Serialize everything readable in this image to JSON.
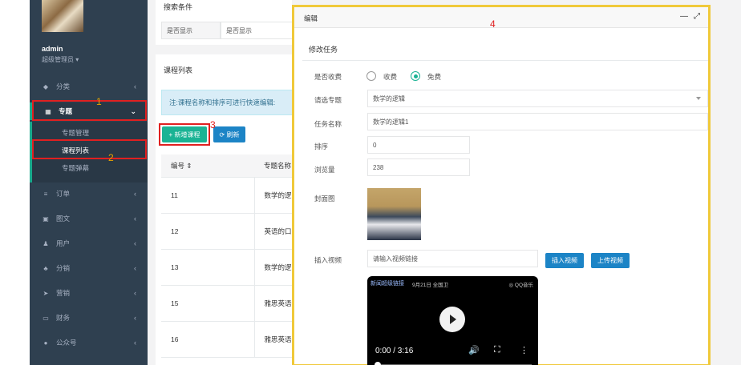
{
  "sidebar": {
    "user_name": "admin",
    "user_role": "超级管理员 ▾",
    "items": [
      {
        "icon": "◆",
        "icon_name": "tag-icon",
        "label": "分类",
        "chev": "‹"
      },
      {
        "icon": "▦",
        "icon_name": "grid-icon",
        "label": "专题",
        "chev": "⌄"
      },
      {
        "icon": "≡",
        "icon_name": "list-icon",
        "label": "订单",
        "chev": "‹"
      },
      {
        "icon": "▣",
        "icon_name": "image-icon",
        "label": "图文",
        "chev": "‹"
      },
      {
        "icon": "♟",
        "icon_name": "user-icon",
        "label": "用户",
        "chev": "‹"
      },
      {
        "icon": "♣",
        "icon_name": "users-icon",
        "label": "分销",
        "chev": "‹"
      },
      {
        "icon": "➤",
        "icon_name": "send-icon",
        "label": "营销",
        "chev": "‹"
      },
      {
        "icon": "▭",
        "icon_name": "finance-icon",
        "label": "财务",
        "chev": "‹"
      },
      {
        "icon": "●",
        "icon_name": "wechat-icon",
        "label": "公众号",
        "chev": "‹"
      }
    ],
    "sub_items": [
      "专题管理",
      "课程列表",
      "专题弹幕"
    ]
  },
  "annotations": {
    "a1": "1",
    "a2": "2",
    "a3": "3",
    "a4": "4"
  },
  "search": {
    "title": "搜索条件",
    "label": "是否显示",
    "select_value": "是否显示"
  },
  "course_list": {
    "title": "课程列表",
    "notice": "注:课程名称和排序可进行快速编辑:",
    "add_button": "+ 新增课程",
    "refresh_button": "⟳ 刷新",
    "columns": [
      "编号 ⇕",
      "专题名称"
    ],
    "rows": [
      [
        "11",
        "数学的逻"
      ],
      [
        "12",
        "英语的口"
      ],
      [
        "13",
        "数学的逻"
      ],
      [
        "15",
        "雅思英语"
      ],
      [
        "16",
        "雅思英语"
      ]
    ]
  },
  "modal": {
    "title": "编辑",
    "minimize": "—",
    "maximize": "⤢",
    "section": "修改任务",
    "charge_label": "是否收费",
    "charge_options": [
      "收费",
      "免费"
    ],
    "charge_selected": "免费",
    "topic_label": "请选专题",
    "topic_value": "数学的逻辑",
    "name_label": "任务名称",
    "name_value": "数学的逻辑1",
    "sort_label": "排序",
    "sort_value": "0",
    "views_label": "浏览量",
    "views_value": "238",
    "cover_label": "封面图",
    "video_label": "插入视频",
    "video_placeholder": "请输入视频链接",
    "insert_video_button": "插入视频",
    "upload_video_button": "上传视频",
    "video": {
      "top_text": "新闻超级链接",
      "date_text": "9月21日 全国卫",
      "brand_text": "◎ QQ音乐",
      "time": "0:00 / 3:16",
      "controls": [
        "🔊",
        "⛶",
        "⋮"
      ]
    }
  },
  "colors": {
    "sidebar_bg": "#2f4050",
    "accent_green": "#1ab394",
    "accent_blue": "#1c84c6",
    "highlight_red": "#e02020",
    "highlight_yellow": "#f0c93a"
  }
}
